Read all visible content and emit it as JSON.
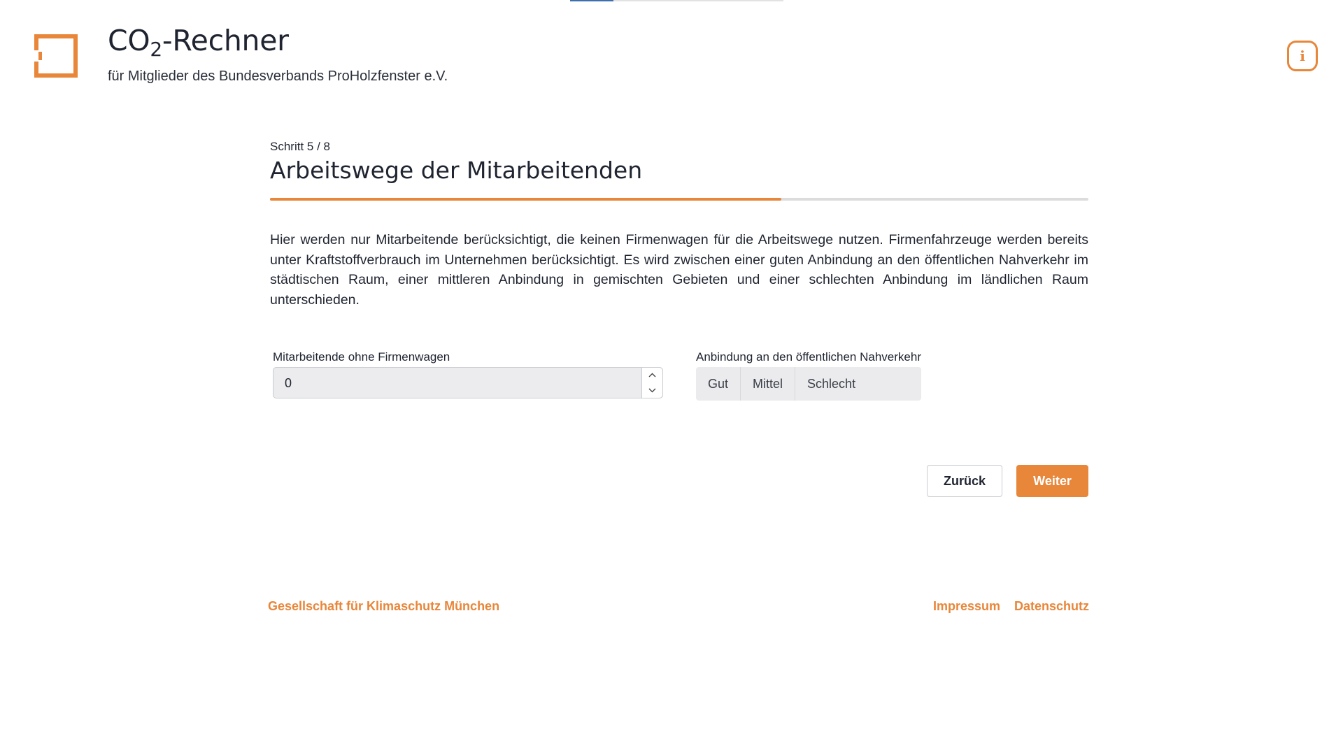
{
  "header": {
    "title_prefix": "CO",
    "title_sub": "2",
    "title_suffix": "-Rechner",
    "subtitle": "für Mitglieder des Bundesverbands ProHolzfenster e.V.",
    "info_glyph": "i"
  },
  "icons": {
    "logo": "window-frame-logo",
    "info": "info-icon",
    "stepper_up": "chevron-up-icon",
    "stepper_down": "chevron-down-icon"
  },
  "colors": {
    "accent": "#e8863a",
    "text": "#1f2430",
    "progress_track": "#dcdcdc",
    "top_indicator": "#3d6fae"
  },
  "step": {
    "label": "Schritt 5 / 8",
    "current": 5,
    "total": 8,
    "progress_fraction": 0.625
  },
  "page": {
    "title": "Arbeitswege der Mitarbeitenden",
    "description": "Hier werden nur Mitarbeitende berücksichtigt, die keinen Firmenwagen für die Arbeitswege nutzen. Firmenfahrzeuge werden bereits unter Kraftstoffverbrauch im Unternehmen berücksichtigt. Es wird zwischen einer guten Anbindung an den öffentlichen Nahverkehr im städtischen Raum, einer mittleren Anbindung in gemischten Gebieten und einer schlechten Anbindung im ländlichen Raum unterschieden."
  },
  "form": {
    "employees": {
      "label": "Mitarbeitende ohne Firmenwagen",
      "value": "0"
    },
    "transit": {
      "label": "Anbindung an den öffentlichen Nahverkehr",
      "options": [
        "Gut",
        "Mittel",
        "Schlecht"
      ]
    }
  },
  "nav": {
    "back_label": "Zurück",
    "next_label": "Weiter"
  },
  "footer": {
    "org": "Gesellschaft für Klimaschutz München",
    "imprint": "Impressum",
    "privacy": "Datenschutz"
  }
}
